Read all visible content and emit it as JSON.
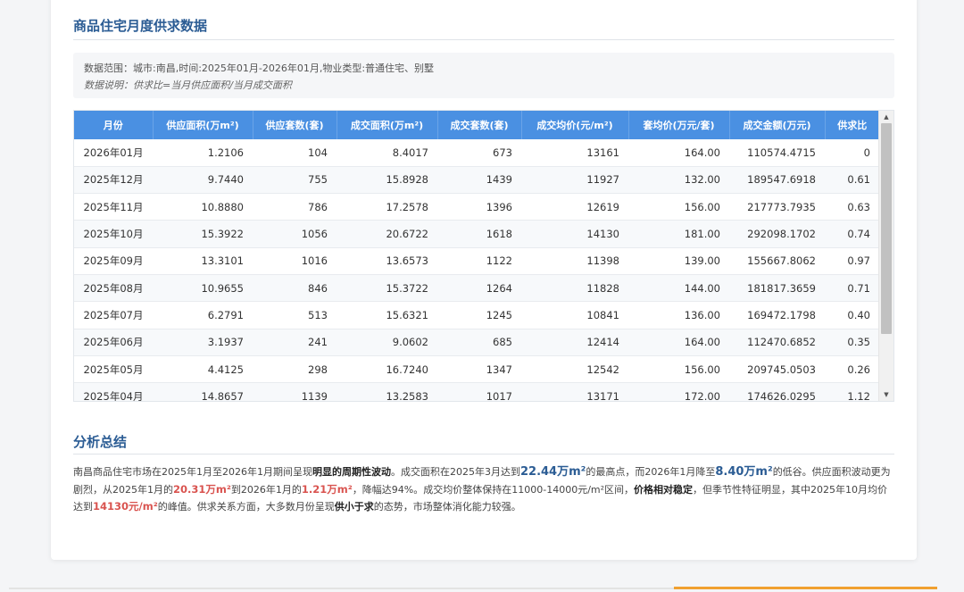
{
  "title": "商品住宅月度供求数据",
  "info": {
    "scope": "数据范围：城市:南昌,时间:2025年01月-2026年01月,物业类型:普通住宅、别墅",
    "note": "数据说明：供求比=当月供应面积/当月成交面积"
  },
  "table": {
    "headers": [
      "月份",
      "供应面积(万m²)",
      "供应套数(套)",
      "成交面积(万m²)",
      "成交套数(套)",
      "成交均价(元/m²)",
      "套均价(万元/套)",
      "成交金额(万元)",
      "供求比"
    ],
    "rows": [
      [
        "2026年01月",
        "1.2106",
        "104",
        "8.4017",
        "673",
        "13161",
        "164.00",
        "110574.4715",
        "0"
      ],
      [
        "2025年12月",
        "9.7440",
        "755",
        "15.8928",
        "1439",
        "11927",
        "132.00",
        "189547.6918",
        "0.61"
      ],
      [
        "2025年11月",
        "10.8880",
        "786",
        "17.2578",
        "1396",
        "12619",
        "156.00",
        "217773.7935",
        "0.63"
      ],
      [
        "2025年10月",
        "15.3922",
        "1056",
        "20.6722",
        "1618",
        "14130",
        "181.00",
        "292098.1702",
        "0.74"
      ],
      [
        "2025年09月",
        "13.3101",
        "1016",
        "13.6573",
        "1122",
        "11398",
        "139.00",
        "155667.8062",
        "0.97"
      ],
      [
        "2025年08月",
        "10.9655",
        "846",
        "15.3722",
        "1264",
        "11828",
        "144.00",
        "181817.3659",
        "0.71"
      ],
      [
        "2025年07月",
        "6.2791",
        "513",
        "15.6321",
        "1245",
        "10841",
        "136.00",
        "169472.1798",
        "0.40"
      ],
      [
        "2025年06月",
        "3.1937",
        "241",
        "9.0602",
        "685",
        "12414",
        "164.00",
        "112470.6852",
        "0.35"
      ],
      [
        "2025年05月",
        "4.4125",
        "298",
        "16.7240",
        "1347",
        "12542",
        "156.00",
        "209745.0503",
        "0.26"
      ],
      [
        "2025年04月",
        "14.8657",
        "1139",
        "13.2583",
        "1017",
        "13171",
        "172.00",
        "174626.0295",
        "1.12"
      ]
    ]
  },
  "summary_title": "分析总结",
  "summary": {
    "p1": "南昌商品住宅市场在2025年1月至2026年1月期间呈现",
    "b1": "明显的周期性波动",
    "p2": "。成交面积在2025年3月达到",
    "h1": "22.44万m²",
    "p3": "的最高点，而2026年1月降至",
    "h2": "8.40万m²",
    "p4": "的低谷。供应面积波动更为剧烈，从2025年1月的",
    "r1": "20.31万m²",
    "p5": "到2026年1月的",
    "r2": "1.21万m²",
    "p6": "，降幅达94%。成交均价整体保持在11000-14000元/m²区间，",
    "b2": "价格相对稳定",
    "p7": "，但季节性特征明显，其中2025年10月均价达到",
    "r3": "14130元/m²",
    "p8": "的峰值。供求关系方面，大多数月份呈现",
    "b3": "供小于求",
    "p9": "的态势，市场整体消化能力较强。"
  },
  "colors": {
    "title": "#2b5c94",
    "header_bg": "#4a90e2",
    "highlight_red": "#d9534f",
    "accent": "#f0a030"
  }
}
